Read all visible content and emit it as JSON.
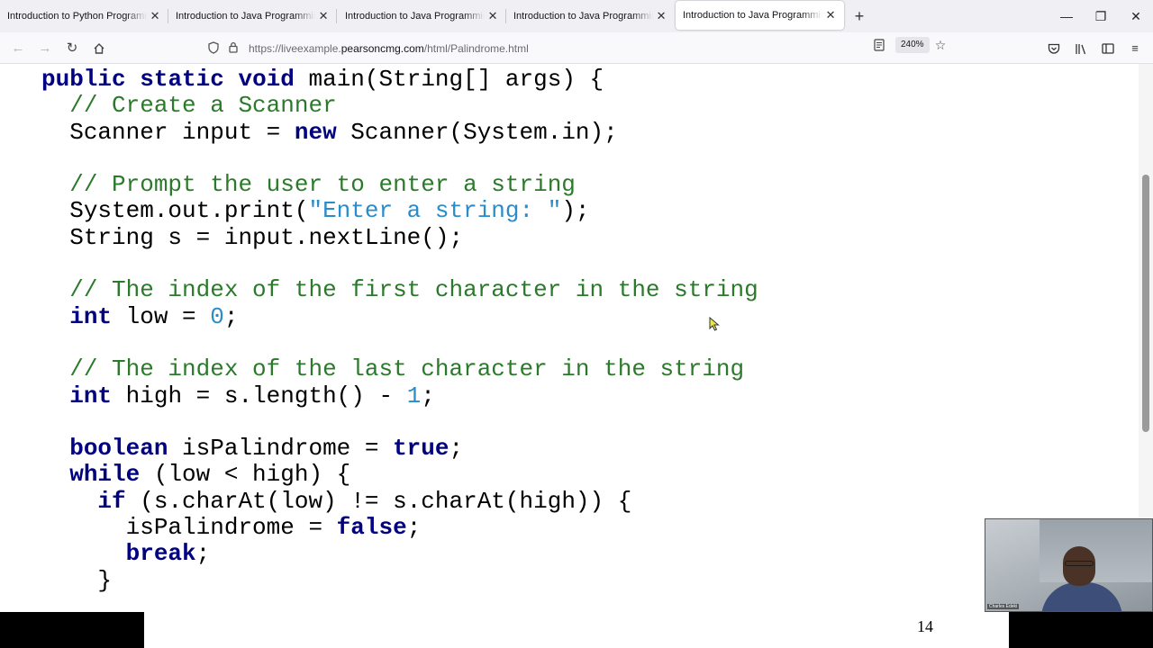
{
  "tabs": [
    {
      "title": "Introduction to Python Programming and Data Structures"
    },
    {
      "title": "Introduction to Java Programming and Data Structures"
    },
    {
      "title": "Introduction to Java Programming and Data Structures"
    },
    {
      "title": "Introduction to Java Programming and Data Structures"
    },
    {
      "title": "Introduction to Java Programming and Data Structures",
      "active": true
    }
  ],
  "nav": {
    "url_prefix": "https://liveexample.",
    "url_domain": "pearsoncmg.com",
    "url_path": "/html/Palindrome.html",
    "zoom": "240%"
  },
  "icons": {
    "tab_close": "close-icon",
    "new_tab": "plus-icon",
    "back": "arrow-left-icon",
    "forward": "arrow-right-icon",
    "reload": "reload-icon",
    "home": "home-icon",
    "tracking": "shield-icon",
    "secure": "lock-icon",
    "reader": "reader-view-icon",
    "bookmark": "star-icon",
    "pocket": "pocket-icon",
    "library": "library-icon",
    "sidebar": "sidebar-icon",
    "menu": "hamburger-menu-icon"
  },
  "code": {
    "l1": {
      "kw1": "public",
      "kw2": "static",
      "kw3": "void",
      "rest": " main(String[] args) {"
    },
    "l2": {
      "comment": "// Create a Scanner"
    },
    "l3": {
      "pre": "Scanner input = ",
      "kw": "new",
      "post": " Scanner(System.in);"
    },
    "l5": {
      "comment": "// Prompt the user to enter a string"
    },
    "l6": {
      "pre": "System.out.print(",
      "str": "\"Enter a string: \"",
      "post": ");"
    },
    "l7": {
      "text": "String s = input.nextLine();"
    },
    "l9": {
      "comment": "// The index of the first character in the string"
    },
    "l10": {
      "kw": "int",
      "pre": " low = ",
      "num": "0",
      "post": ";"
    },
    "l12": {
      "comment": "// The index of the last character in the string"
    },
    "l13": {
      "kw": "int",
      "pre": " high = s.length() - ",
      "num": "1",
      "post": ";"
    },
    "l15": {
      "kw": "boolean",
      "pre": " isPalindrome = ",
      "kw2": "true",
      "post": ";"
    },
    "l16": {
      "kw": "while",
      "post": " (low < high) {"
    },
    "l17": {
      "kw": "if",
      "post": " (s.charAt(low) != s.charAt(high)) {"
    },
    "l18": {
      "pre": "isPalindrome = ",
      "kw": "false",
      "post": ";"
    },
    "l19": {
      "kw": "break",
      "post": ";"
    },
    "l20": {
      "text": "}"
    }
  },
  "slide": {
    "page_number": "14"
  },
  "video": {
    "name": "Charles Edeki"
  },
  "colors": {
    "keyword": "#000080",
    "comment": "#2b7a2b",
    "string": "#2a8cc8"
  }
}
